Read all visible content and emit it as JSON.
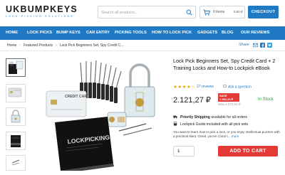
{
  "logo": {
    "main_left": "UK",
    "main_right": "BUMPKEYS",
    "tagline": "LOCK PICKING SOLUTIONS"
  },
  "search": {
    "placeholder": "Search all products..."
  },
  "cart": {
    "items": "0 items",
    "price": "0.00 ₽",
    "checkout_label": "CHECKOUT"
  },
  "nav": {
    "items": [
      "HOME",
      "LOCK PICKS",
      "BUMP KEYS",
      "CAR ENTRY",
      "PICKING TOOLS",
      "HOW TO LOCK PICK",
      "GADGETS",
      "BLOG",
      "OUR REVIEWS"
    ]
  },
  "breadcrumb": {
    "items": [
      "Home",
      "Featured Products",
      "Lock Pick Beginners Set, Spy Credit C..."
    ]
  },
  "share": {
    "label": "Share"
  },
  "product": {
    "title": "Lock Pick Beginners Set, Spy Credit Card + 2 Training Locks and How-to Lockpick eBook",
    "rating_stars": "★★★★☆",
    "reviews": "27 reviews",
    "ask": "Ask a question",
    "price": "2.121,27 ₽",
    "save_line1": "SAVE",
    "save_line2": "1.952,34 ₽",
    "was": "Was 4.073,61 ₽",
    "stock": "In Stock",
    "feature1_bold": "Priority Shipping",
    "feature1_rest": " available for all orders",
    "feature2": "Lockpick Guide included with all pick sets",
    "description": "You want to learn how to pick a lock, or you enjoy intellectual puzzles with a practical slant. Great, you've come t...",
    "more": "more",
    "quantity": "1",
    "add_to_cart": "ADD TO CART"
  },
  "image": {
    "book_title": "LOCKPICKING",
    "card_label": "CREDIT CARD"
  },
  "colors": {
    "brand_blue": "#1f7ac3",
    "sale_red": "#e53935",
    "stock_green": "#2e9b3a",
    "star": "#f0a500"
  }
}
